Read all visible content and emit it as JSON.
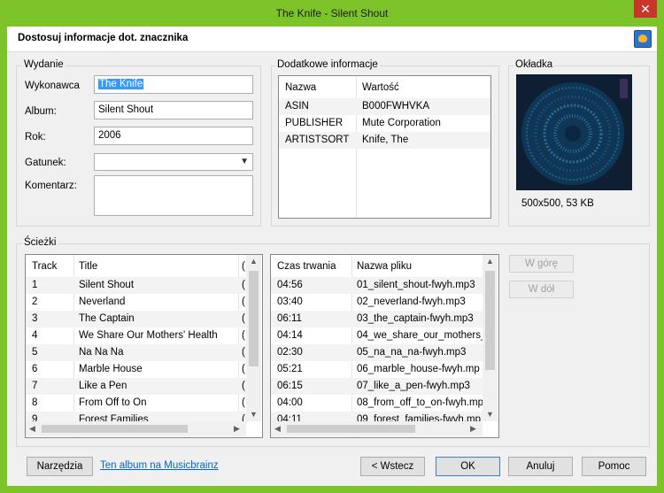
{
  "window": {
    "title": "The Knife - Silent Shout"
  },
  "header": {
    "title": "Dostosuj informacje dot. znacznika"
  },
  "release": {
    "group_label": "Wydanie",
    "artist_label": "Wykonawca",
    "artist_value": "The Knife",
    "album_label": "Album:",
    "album_value": "Silent Shout",
    "year_label": "Rok:",
    "year_value": "2006",
    "genre_label": "Gatunek:",
    "genre_value": "",
    "comment_label": "Komentarz:",
    "comment_value": ""
  },
  "extra": {
    "group_label": "Dodatkowe informacje",
    "col_name": "Nazwa",
    "col_value": "Wartość",
    "rows": [
      {
        "name": "ASIN",
        "value": "B000FWHVKA"
      },
      {
        "name": "PUBLISHER",
        "value": "Mute Corporation"
      },
      {
        "name": "ARTISTSORT",
        "value": "Knife, The"
      }
    ]
  },
  "cover": {
    "group_label": "Okładka",
    "info": "500x500, 53 KB"
  },
  "tracks": {
    "group_label": "Ścieżki",
    "left_cols": {
      "track": "Track",
      "title": "Title"
    },
    "right_cols": {
      "duration": "Czas trwania",
      "filename": "Nazwa pliku"
    },
    "rows": [
      {
        "track": "1",
        "title": "Silent Shout",
        "duration": "04:56",
        "file": "01_silent_shout-fwyh.mp3"
      },
      {
        "track": "2",
        "title": "Neverland",
        "duration": "03:40",
        "file": "02_neverland-fwyh.mp3"
      },
      {
        "track": "3",
        "title": "The Captain",
        "duration": "06:11",
        "file": "03_the_captain-fwyh.mp3"
      },
      {
        "track": "4",
        "title": "We Share Our Mothers' Health",
        "duration": "04:14",
        "file": "04_we_share_our_mothers_"
      },
      {
        "track": "5",
        "title": "Na Na Na",
        "duration": "02:30",
        "file": "05_na_na_na-fwyh.mp3"
      },
      {
        "track": "6",
        "title": "Marble House",
        "duration": "05:21",
        "file": "06_marble_house-fwyh.mp"
      },
      {
        "track": "7",
        "title": "Like a Pen",
        "duration": "06:15",
        "file": "07_like_a_pen-fwyh.mp3"
      },
      {
        "track": "8",
        "title": "From Off to On",
        "duration": "04:00",
        "file": "08_from_off_to_on-fwyh.mp"
      },
      {
        "track": "9",
        "title": "Forest Families",
        "duration": "04:11",
        "file": "09_forest_families-fwyh.mp"
      }
    ],
    "up_button": "W górę",
    "down_button": "W dół"
  },
  "footer": {
    "tools_button": "Narzędzia",
    "musicbrainz_link": "Ten album na Musicbrainz",
    "back_button": "< Wstecz",
    "ok_button": "OK",
    "cancel_button": "Anuluj",
    "help_button": "Pomoc"
  }
}
